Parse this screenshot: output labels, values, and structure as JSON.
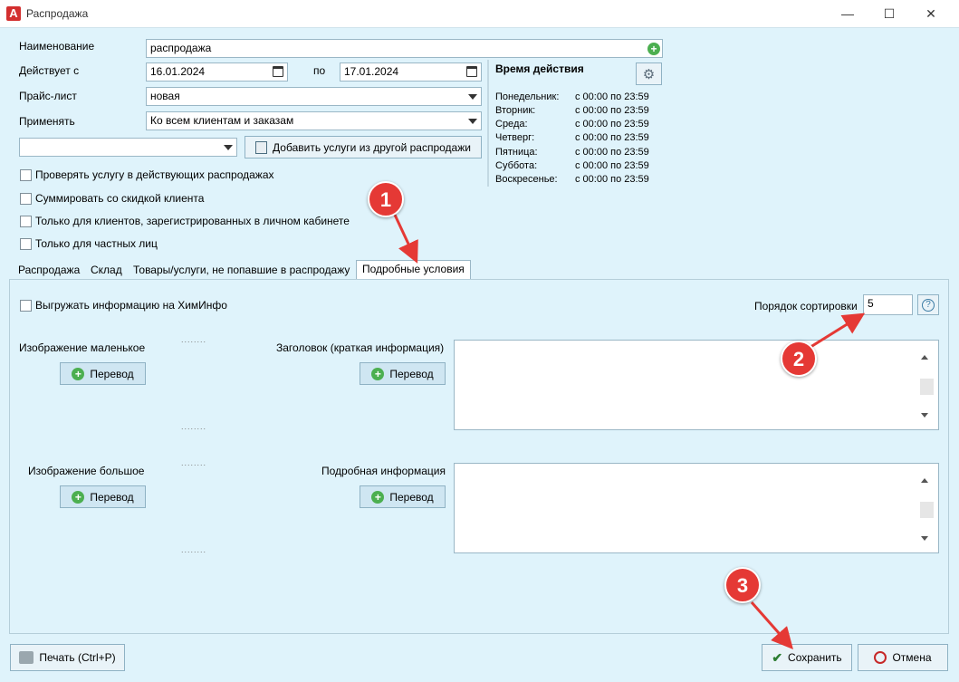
{
  "window": {
    "title": "Распродажа",
    "app_icon_letter": "A",
    "minimize": "—",
    "maximize": "☐",
    "close": "✕"
  },
  "form": {
    "name_label": "Наименование",
    "name_value": "распродажа",
    "valid_from_label": "Действует с",
    "valid_from": "16.01.2024",
    "to_label": "по",
    "valid_to": "17.01.2024",
    "price_list_label": "Прайс-лист",
    "price_list": "новая",
    "apply_label": "Применять",
    "apply_value": "Ко всем клиентам и заказам",
    "extra_combo": "",
    "add_services_button": "Добавить услуги из другой распродажи"
  },
  "checkboxes": [
    {
      "label": "Проверять услугу в действующих распродажах",
      "checked": false
    },
    {
      "label": "Суммировать со скидкой клиента",
      "checked": false
    },
    {
      "label": "Только для клиентов, зарегистрированных в личном кабинете",
      "checked": false
    },
    {
      "label": "Только для частных лиц",
      "checked": false
    }
  ],
  "schedule": {
    "title": "Время действия",
    "rows": [
      {
        "day": "Понедельник:",
        "time": "с 00:00 по 23:59"
      },
      {
        "day": "Вторник:",
        "time": "с 00:00 по 23:59"
      },
      {
        "day": "Среда:",
        "time": "с 00:00 по 23:59"
      },
      {
        "day": "Четверг:",
        "time": "с 00:00 по 23:59"
      },
      {
        "day": "Пятница:",
        "time": "с 00:00 по 23:59"
      },
      {
        "day": "Суббота:",
        "time": "с 00:00 по 23:59"
      },
      {
        "day": "Воскресенье:",
        "time": "с 00:00 по 23:59"
      }
    ]
  },
  "tabs": [
    {
      "label": "Распродажа"
    },
    {
      "label": "Склад"
    },
    {
      "label": "Товары/услуги, не попавшие в распродажу"
    },
    {
      "label": "Подробные условия",
      "active": true
    }
  ],
  "details": {
    "export_checkbox": "Выгружать информацию на ХимИнфо",
    "sort_order_label": "Порядок сортировки",
    "sort_order_value": "5",
    "help": "?",
    "small_image_label": "Изображение маленькое",
    "large_image_label": "Изображение большое",
    "header_label": "Заголовок (краткая информация)",
    "detail_label": "Подробная информация",
    "translate_button": "Перевод",
    "dots": "........"
  },
  "footer": {
    "print_button": "Печать (Ctrl+P)",
    "save_button": "Сохранить",
    "cancel_button": "Отмена"
  },
  "annotations": {
    "m1": "1",
    "m2": "2",
    "m3": "3"
  },
  "colors": {
    "accent": "#e53935",
    "background": "#dff3fb",
    "plus_green": "#4caf50"
  }
}
